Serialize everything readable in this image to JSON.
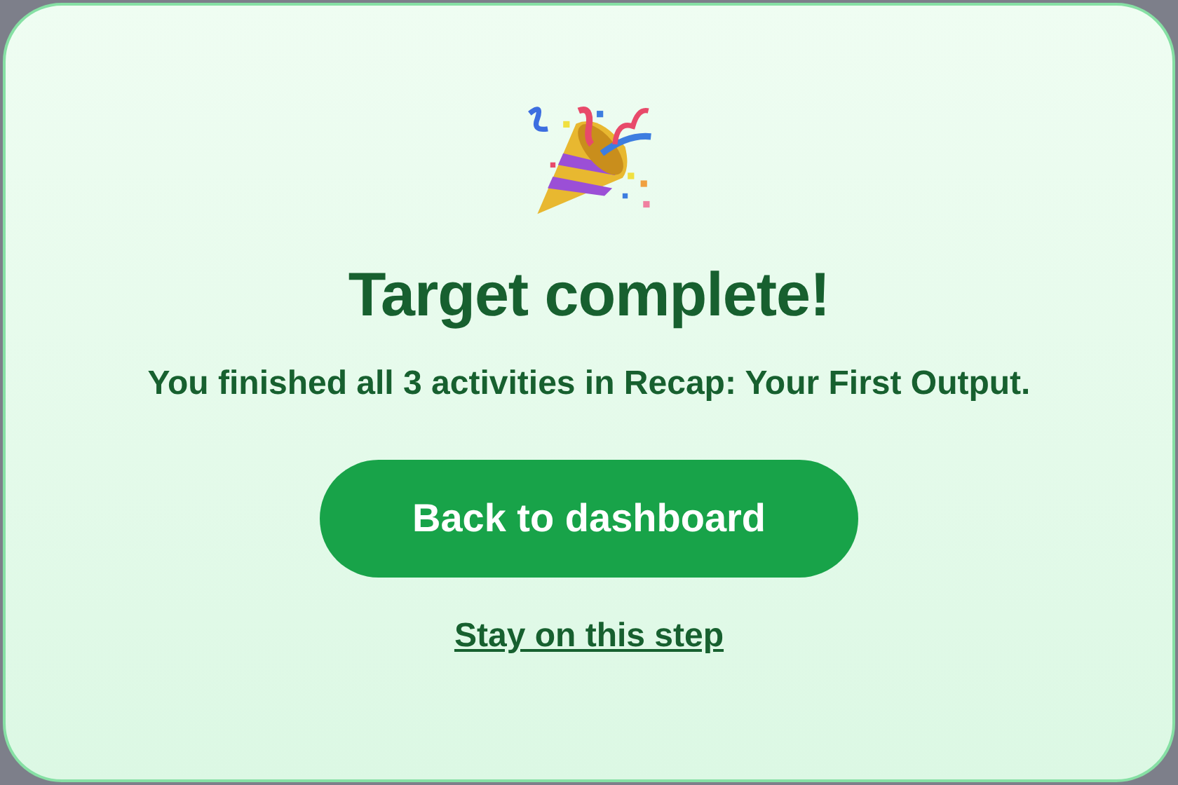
{
  "dialog": {
    "title": "Target complete!",
    "message": "You finished all 3 activities in Recap: Your First Output.",
    "primary_button": "Back to dashboard",
    "secondary_link": "Stay on this step"
  }
}
